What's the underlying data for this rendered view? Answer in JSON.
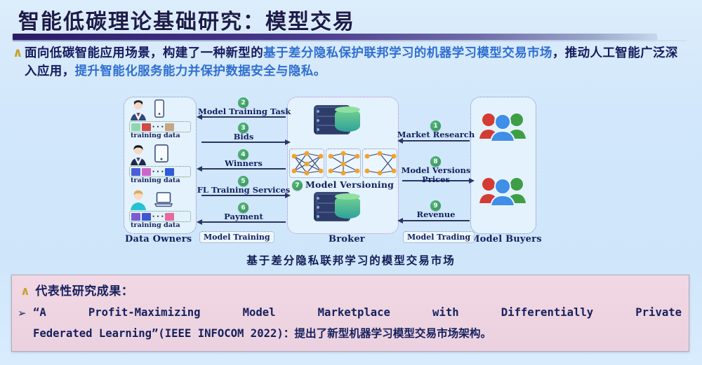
{
  "slide": {
    "title": "智能低碳理论基础研究：模型交易",
    "bullet_marker": "∧",
    "paragraph": {
      "seg1": "面向低碳智能应用场景，构建了一种新型的",
      "seg2_highlight": "基于差分隐私保护联邦学习的机器学习模型交易市场",
      "seg3": "，推动人工智能广泛深入应用，",
      "seg4_highlight": "提升智能化服务能力并保护数据安全与隐私。"
    },
    "figure_caption": "基于差分隐私联邦学习的模型交易市场"
  },
  "diagram": {
    "panels": {
      "owners": "Data Owners",
      "broker": "Broker",
      "buyers": "Model Buyers"
    },
    "tags": {
      "model_training": "Model Training",
      "model_trading": "Model Trading"
    },
    "model_versioning": {
      "badge": "7",
      "label": "Model Versioning"
    },
    "training_data_label": "training data",
    "dots": "• • •",
    "left_flows": [
      {
        "badge": "2",
        "label": "Model Training Task",
        "direction": "left"
      },
      {
        "badge": "3",
        "label": "Bids",
        "direction": "right"
      },
      {
        "badge": "4",
        "label": "Winners",
        "direction": "left"
      },
      {
        "badge": "5",
        "label": "FL Training Services",
        "direction": "right"
      },
      {
        "badge": "6",
        "label": "Payment",
        "direction": "left"
      }
    ],
    "right_flows": [
      {
        "badge": "1",
        "label": "Market Research",
        "label2": "",
        "direction": "left"
      },
      {
        "badge": "8",
        "label": "Model Versions",
        "label2": "Prices",
        "direction": "right"
      },
      {
        "badge": "9",
        "label": "Revenue",
        "label2": "",
        "direction": "left"
      }
    ],
    "owners": [
      {
        "blocks": [
          "#8fd6b0",
          "#d24b45",
          "#c7a583"
        ]
      },
      {
        "blocks": [
          "#4a5ed8",
          "#cc66cc",
          "#2f5bd8"
        ]
      },
      {
        "blocks": [
          "#7b5cd6",
          "#3f56d2",
          "#e8699f"
        ]
      }
    ]
  },
  "results_box": {
    "heading_marker": "∧",
    "heading": "代表性研究成果：",
    "item_marker": "➢",
    "line1": "“A  Profit-Maximizing  Model  Marketplace  with  Differentially  Private",
    "line2_en": "Federated Learning”(IEEE INFOCOM 2022)：",
    "line2_cn": "提出了新型机器学习模型交易市场架构。"
  },
  "colors": {
    "background": "#d2e7fb",
    "title_text": "#1d1b4a",
    "highlight_blue": "#2f6fd0",
    "badge_green": "#2f9255",
    "pink_box": "#eed4e1",
    "gold_marker": "#c8a22c"
  }
}
